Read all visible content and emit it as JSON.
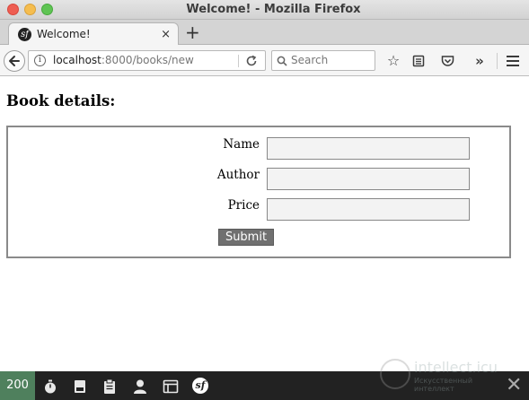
{
  "window": {
    "title": "Welcome! - Mozilla Firefox"
  },
  "tab": {
    "title": "Welcome!",
    "favicon_text": "sf",
    "close_glyph": "×",
    "new_tab_glyph": "+"
  },
  "navbar": {
    "url_host": "localhost",
    "url_rest": ":8000/books/new",
    "search_placeholder": "Search"
  },
  "page": {
    "heading": "Book details:",
    "fields": [
      {
        "label": "Name",
        "value": ""
      },
      {
        "label": "Author",
        "value": ""
      },
      {
        "label": "Price",
        "value": ""
      }
    ],
    "submit_label": "Submit"
  },
  "debug_toolbar": {
    "status_code": "200",
    "logo_text": "sf",
    "colors": {
      "status_bg": "#4f805d",
      "bar_bg": "#222222"
    }
  },
  "watermark": {
    "line1": "intellect.icu",
    "line2": "Искусственный интеллект"
  },
  "icons": [
    "back-arrow-icon",
    "info-icon",
    "reload-icon",
    "search-icon",
    "star-icon",
    "reader-list-icon",
    "pocket-icon",
    "overflow-icon",
    "hamburger-menu-icon",
    "stopwatch-icon",
    "memory-icon",
    "clipboard-icon",
    "user-icon",
    "layout-icon",
    "symfony-logo-icon",
    "close-icon"
  ]
}
